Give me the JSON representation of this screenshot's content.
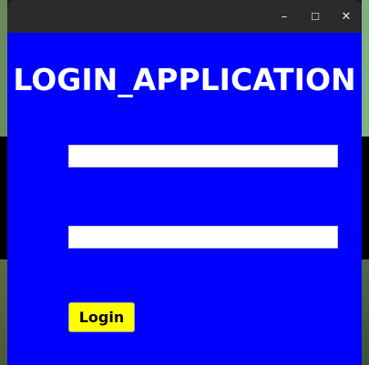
{
  "window": {
    "controls": {
      "minimize": "–",
      "maximize": "☐",
      "close": "✕"
    }
  },
  "app": {
    "title": "LOGIN_APPLICATION",
    "username_value": "",
    "password_value": "",
    "login_label": "Login"
  },
  "colors": {
    "background": "#0000ff",
    "title_text": "#ffffff",
    "button_bg": "#ffff00",
    "titlebar": "#2b2b2b"
  }
}
